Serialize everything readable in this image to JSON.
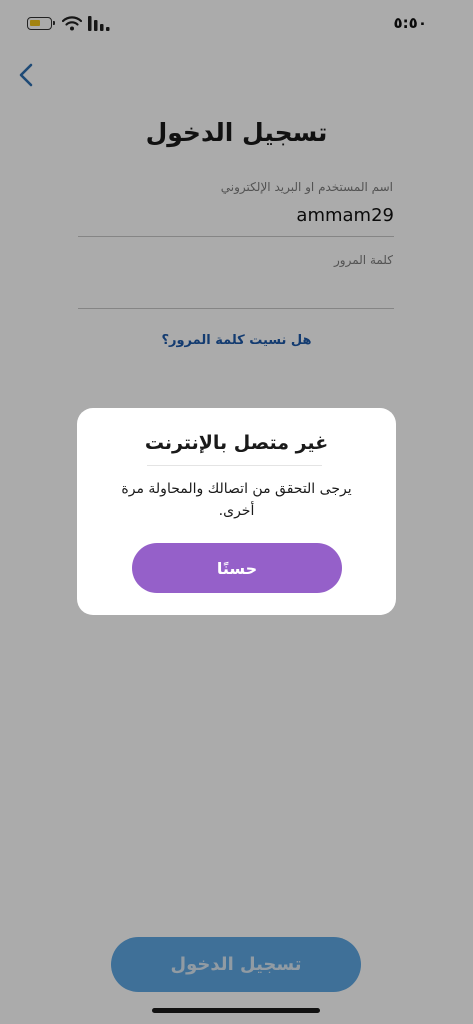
{
  "status_bar": {
    "time": "٥:٥٠",
    "battery_level": 0.55,
    "battery_color": "#f2c418"
  },
  "header": {
    "back_icon": "chevron-left-icon",
    "title": "تسجيل الدخول"
  },
  "form": {
    "username": {
      "label": "اسم المستخدم او البريد الإلكتروني",
      "value": "ammam29"
    },
    "password": {
      "label": "كلمة المرور",
      "value": ""
    },
    "forgot_password": "هل نسيت كلمة المرور؟",
    "login_button": "تسجيل الدخول"
  },
  "dialog": {
    "title": "غير متصل بالإنترنت",
    "message": "يرجى التحقق من اتصالك والمحاولة مرة أخرى.",
    "ok_button": "حسنًا"
  },
  "colors": {
    "accent_purple": "#9560c9",
    "login_blue": "#5ea8e3",
    "link_blue": "#1d59a8"
  }
}
